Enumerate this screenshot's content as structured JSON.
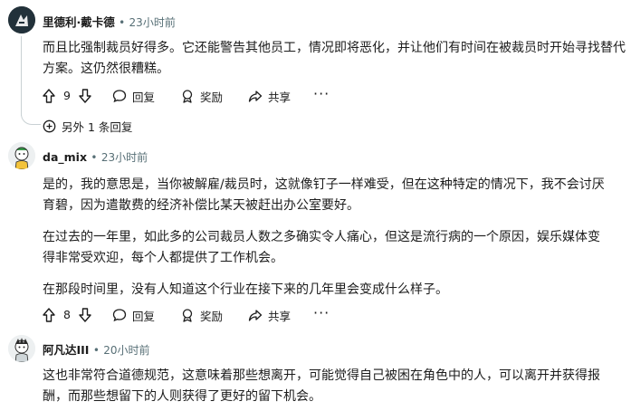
{
  "comments": [
    {
      "author": "里德利·戴卡德",
      "time": "23小时前",
      "paragraphs": [
        "而且比强制裁员好得多。它还能警告其他员工，情况即将恶化，并让他们有时间在被裁员时开始寻找替代方案。这仍然很糟糕。"
      ],
      "votes": "9",
      "reply_label": "回复",
      "award_label": "奖励",
      "share_label": "共享",
      "more_label": "···",
      "more_replies_label": "另外 1 条回复"
    },
    {
      "author": "da_mix",
      "time": "23小时前",
      "paragraphs": [
        "是的，我的意思是，当你被解雇/裁员时，这就像钉子一样难受，但在这种特定的情况下，我不会讨厌育碧，因为遣散费的经济补偿比某天被赶出办公室要好。",
        "在过去的一年里，如此多的公司裁员人数之多确实令人痛心，但这是流行病的一个原因，娱乐媒体变得非常受欢迎，每个人都提供了工作机会。",
        "在那段时间里，没有人知道这个行业在接下来的几年里会变成什么样子。"
      ],
      "votes": "8",
      "reply_label": "回复",
      "award_label": "奖励",
      "share_label": "共享",
      "more_label": "···"
    },
    {
      "author": "阿凡达III",
      "time": "20小时前",
      "paragraphs": [
        "这也非常符合道德规范，这意味着那些想离开，可能觉得自己被困在角色中的人，可以离开并获得报酬，而那些想留下的人则获得了更好的留下机会。"
      ]
    }
  ],
  "separator": "•"
}
